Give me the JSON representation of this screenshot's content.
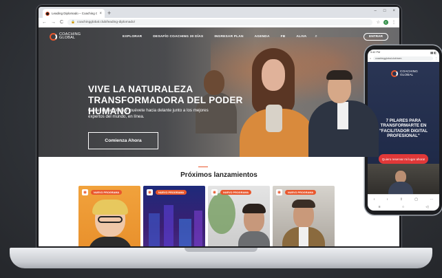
{
  "browser": {
    "tab_title": "Leading Diplomado – Coaching Glo…",
    "tab_close": "×",
    "new_tab": "+",
    "url": "coachingglobal.club/leading-diplomado/",
    "back": "←",
    "forward": "→",
    "reload": "C",
    "profile_initial": "C"
  },
  "site": {
    "logo_line1": "COACHING",
    "logo_line2": "GLOBAL",
    "nav": [
      "EXPLORAR",
      "DESAFÍO COACHING 30 DÍAS",
      "INGRESAR PLAN",
      "AGENDA",
      "FB",
      "ALIVA"
    ],
    "enter_button": "ENTRAR",
    "hero_title": "VIVE LA NATURALEZA TRANSFORMADORA DEL PODER HUMANO",
    "hero_subtitle": "Crece, desarróllate y muévete hacia delante junto a los mejores expertos del mundo, en línea.",
    "cta": "Comienza Ahora",
    "section_title": "Próximos lanzamientos",
    "cards": [
      {
        "tag": "NUEVO PROGRAMA"
      },
      {
        "tag": "NUEVO PROGRAMA"
      },
      {
        "tag": "NUEVO PROGRAMA"
      },
      {
        "tag": "NUEVO PROGRAMA"
      }
    ]
  },
  "phone": {
    "time": "5:42 PM",
    "status_icons": "▮▮ ◧",
    "url": "coachingglobal.club/sem",
    "logo_line1": "COACHING",
    "logo_line2": "GLOBAL",
    "title": "7 PILARES PARA TRANSFORMARTE EN \"FACILITADOR DIGITAL PROFESIONAL\"",
    "cta": "Quiero reservar mi lugar ahora!"
  },
  "colors": {
    "accent": "#e9572d",
    "phone_bg": "#2a3554",
    "phone_cta": "#e03838"
  }
}
